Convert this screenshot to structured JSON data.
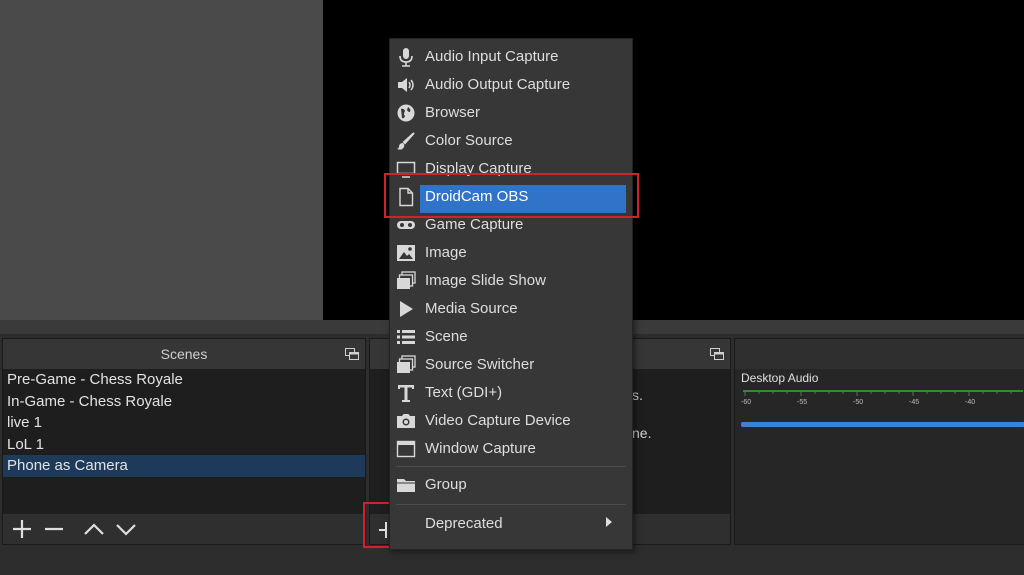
{
  "window": {
    "colors": {
      "preview": "#000000",
      "menu_bg": "#373737",
      "menu_highlight": "#2f74c8",
      "annotation": "#d1202e",
      "selected_scene": "#1e3a5a"
    }
  },
  "scenes": {
    "title": "Scenes",
    "items": [
      {
        "label": "Pre-Game - Chess Royale",
        "selected": false
      },
      {
        "label": "In-Game - Chess Royale",
        "selected": false
      },
      {
        "label": "live 1",
        "selected": false
      },
      {
        "label": "LoL 1",
        "selected": false
      },
      {
        "label": "Phone as Camera",
        "selected": true
      }
    ],
    "toolbar": [
      "plus-icon",
      "minus-icon",
      "up-arrow-icon",
      "down-arrow-icon"
    ]
  },
  "sources": {
    "partial_text_1": "s.",
    "partial_text_2": "ne.",
    "toolbar_icon": "add-icon"
  },
  "audio": {
    "track_name": "Desktop Audio",
    "ticks": [
      "-60",
      "-55",
      "-50",
      "-45",
      "-40"
    ]
  },
  "context_menu": {
    "items": [
      {
        "label": "Audio Input Capture",
        "icon": "microphone-icon"
      },
      {
        "label": "Audio Output Capture",
        "icon": "speaker-icon"
      },
      {
        "label": "Browser",
        "icon": "globe-icon"
      },
      {
        "label": "Color Source",
        "icon": "paintbrush-icon"
      },
      {
        "label": "Display Capture",
        "icon": "monitor-icon"
      },
      {
        "label": "DroidCam OBS",
        "icon": "file-icon",
        "highlighted": true
      },
      {
        "label": "Game Capture",
        "icon": "gamepad-icon"
      },
      {
        "label": "Image",
        "icon": "image-icon"
      },
      {
        "label": "Image Slide Show",
        "icon": "slideshow-icon"
      },
      {
        "label": "Media Source",
        "icon": "play-icon"
      },
      {
        "label": "Scene",
        "icon": "list-icon"
      },
      {
        "label": "Source Switcher",
        "icon": "switcher-icon"
      },
      {
        "label": "Text (GDI+)",
        "icon": "text-icon"
      },
      {
        "label": "Video Capture Device",
        "icon": "camera-icon"
      },
      {
        "label": "Window Capture",
        "icon": "window-icon"
      }
    ],
    "group_label": "Group",
    "group_icon": "folder-icon",
    "deprecated_label": "Deprecated",
    "deprecated_icon": "submenu-arrow-icon"
  }
}
